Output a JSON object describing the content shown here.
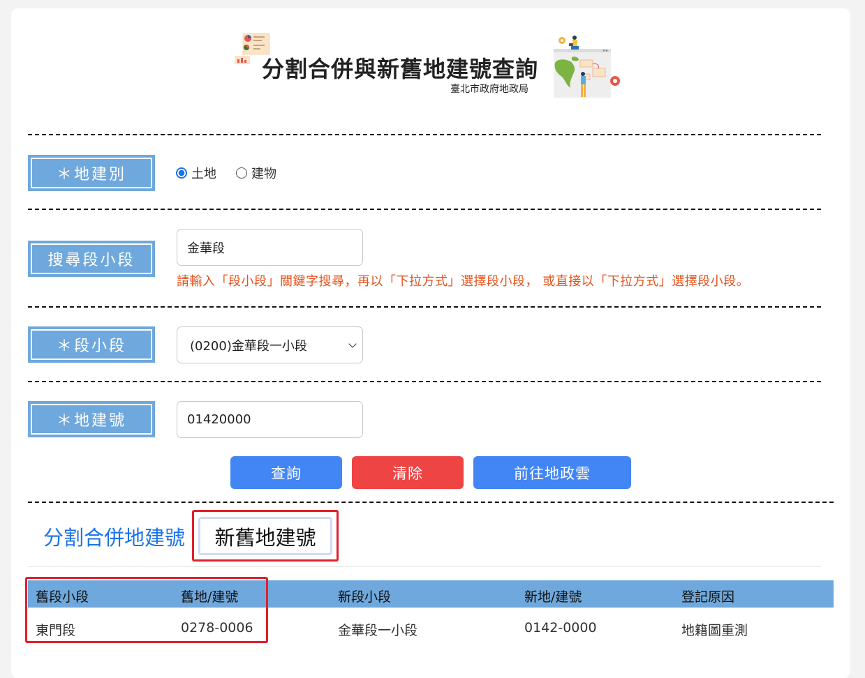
{
  "header": {
    "title": "分割合併與新舊地建號查詢",
    "subtitle": "臺北市政府地政局"
  },
  "form": {
    "type_label": "＊地建別",
    "type_options": [
      {
        "label": "土地",
        "checked": true
      },
      {
        "label": "建物",
        "checked": false
      }
    ],
    "search_label": "搜尋段小段",
    "search_value": "金華段",
    "hint": "請輸入「段小段」關鍵字搜尋，再以「下拉方式」選擇段小段， 或直接以「下拉方式」選擇段小段。",
    "section_label": "＊段小段",
    "section_value": "(0200)金華段一小段",
    "number_label": "＊地建號",
    "number_value": "01420000"
  },
  "buttons": {
    "query": "查詢",
    "clear": "清除",
    "cloud": "前往地政雲"
  },
  "tabs": {
    "split_merge": "分割合併地建號",
    "old_new": "新舊地建號"
  },
  "table": {
    "columns": [
      "舊段小段",
      "舊地/建號",
      "新段小段",
      "新地/建號",
      "登記原因"
    ],
    "rows": [
      [
        "東門段",
        "0278-0006",
        "金華段一小段",
        "0142-0000",
        "地籍圖重測"
      ]
    ]
  },
  "colors": {
    "label_bg": "#6fa8dc",
    "primary": "#4285f4",
    "danger": "#ee4444",
    "hint": "#e8511a",
    "highlight": "#e0202a"
  },
  "icons": {
    "header_left": "report-chart-illustration",
    "header_right": "people-map-illustration",
    "select": "chevron-down-icon"
  }
}
